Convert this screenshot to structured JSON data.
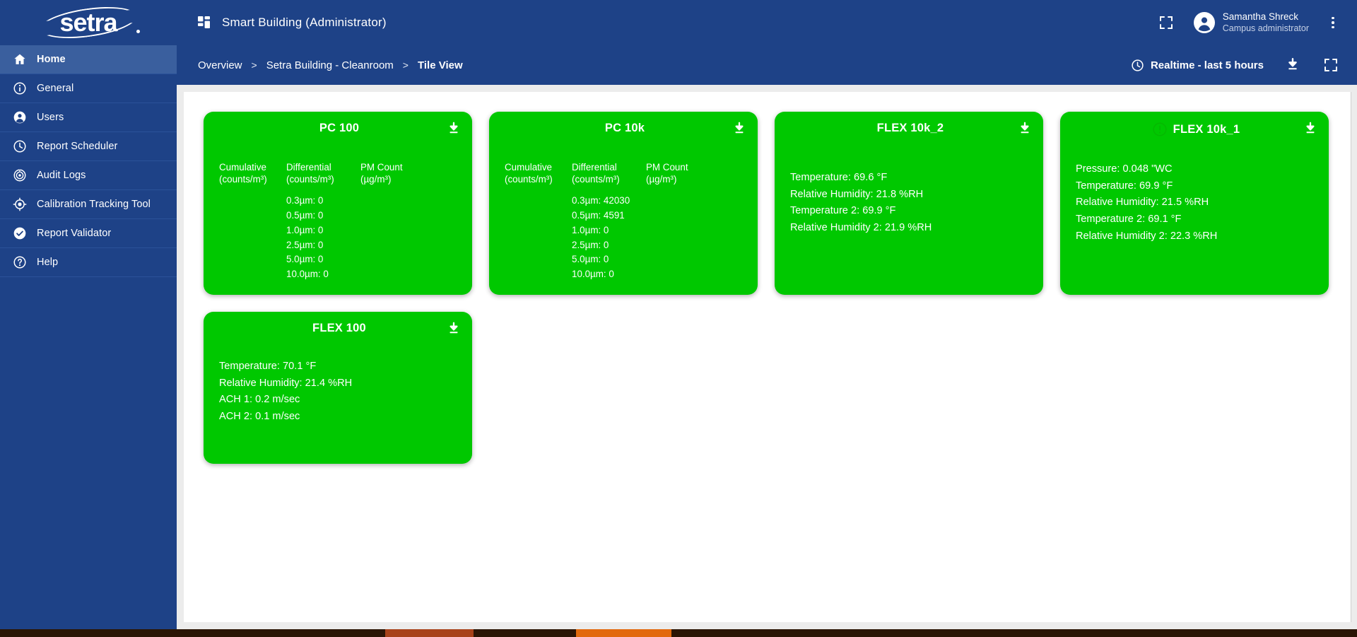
{
  "brand": {
    "logo_text": "setra"
  },
  "colors": {
    "sidebar_blue": "#1e4287",
    "sidebar_active": "#3a5f9e",
    "tile_green": "#00c800",
    "content_gray": "#ececec"
  },
  "sidebar": {
    "items": [
      {
        "label": "Home",
        "icon": "home-icon",
        "active": true
      },
      {
        "label": "General",
        "icon": "info-icon",
        "active": false
      },
      {
        "label": "Users",
        "icon": "user-icon",
        "active": false
      },
      {
        "label": "Report Scheduler",
        "icon": "clock-icon",
        "active": false
      },
      {
        "label": "Audit Logs",
        "icon": "audit-icon",
        "active": false
      },
      {
        "label": "Calibration Tracking Tool",
        "icon": "target-icon",
        "active": false
      },
      {
        "label": "Report Validator",
        "icon": "check-circle-icon",
        "active": false
      },
      {
        "label": "Help",
        "icon": "question-circle-icon",
        "active": false
      }
    ]
  },
  "topbar": {
    "app_title": "Smart Building (Administrator)",
    "grid_icon": "dashboard-grid-icon",
    "fullscreen_icon": "fullscreen-icon",
    "user": {
      "name": "Samantha Shreck",
      "role": "Campus administrator",
      "avatar_icon": "avatar-icon"
    },
    "menu_icon": "kebab-menu-icon"
  },
  "breadcrumb": {
    "items": [
      {
        "label": "Overview",
        "current": false
      },
      {
        "label": "Setra Building - Cleanroom",
        "current": false
      },
      {
        "label": "Tile View",
        "current": true
      }
    ],
    "separator": ">"
  },
  "toolbar": {
    "time_range": "Realtime - last 5 hours",
    "clock_icon": "clock-icon",
    "download_icon": "download-icon",
    "fullscreen_icon": "fullscreen-icon"
  },
  "tiles": [
    {
      "title": "PC 100",
      "type": "particle-counter",
      "alert": false,
      "download_icon": "download-icon",
      "columns": [
        {
          "head": "Cumulative\n(counts/m³)",
          "rows": []
        },
        {
          "head": "Differential\n(counts/m³)",
          "rows": [
            "0.3µm: 0",
            "0.5µm: 0",
            "1.0µm: 0",
            "2.5µm: 0",
            "5.0µm: 0",
            "10.0µm: 0"
          ]
        },
        {
          "head": "PM Count\n(µg/m³)",
          "rows": []
        }
      ]
    },
    {
      "title": "PC 10k",
      "type": "particle-counter",
      "alert": false,
      "download_icon": "download-icon",
      "columns": [
        {
          "head": "Cumulative\n(counts/m³)",
          "rows": []
        },
        {
          "head": "Differential\n(counts/m³)",
          "rows": [
            "0.3µm: 42030",
            "0.5µm: 4591",
            "1.0µm: 0",
            "2.5µm: 0",
            "5.0µm: 0",
            "10.0µm: 0"
          ]
        },
        {
          "head": "PM Count\n(µg/m³)",
          "rows": []
        }
      ]
    },
    {
      "title": "FLEX 10k_2",
      "type": "flex-sensor",
      "alert": false,
      "download_icon": "download-icon",
      "readings": [
        "Temperature: 69.6 °F",
        "Relative Humidity: 21.8 %RH",
        "Temperature 2: 69.9 °F",
        "Relative Humidity 2: 21.9 %RH"
      ]
    },
    {
      "title": "FLEX 10k_1",
      "type": "flex-sensor",
      "alert": true,
      "alert_icon": "alert-circle-icon",
      "download_icon": "download-icon",
      "readings": [
        "Pressure: 0.048 \"WC",
        "Temperature: 69.9 °F",
        "Relative Humidity: 21.5 %RH",
        "Temperature 2: 69.1 °F",
        "Relative Humidity 2: 22.3 %RH"
      ]
    },
    {
      "title": "FLEX 100",
      "type": "flex-sensor",
      "alert": false,
      "download_icon": "download-icon",
      "readings": [
        "Temperature: 70.1 °F",
        "Relative Humidity: 21.4 %RH",
        "ACH 1: 0.2 m/sec",
        "ACH 2: 0.1 m/sec"
      ]
    }
  ]
}
